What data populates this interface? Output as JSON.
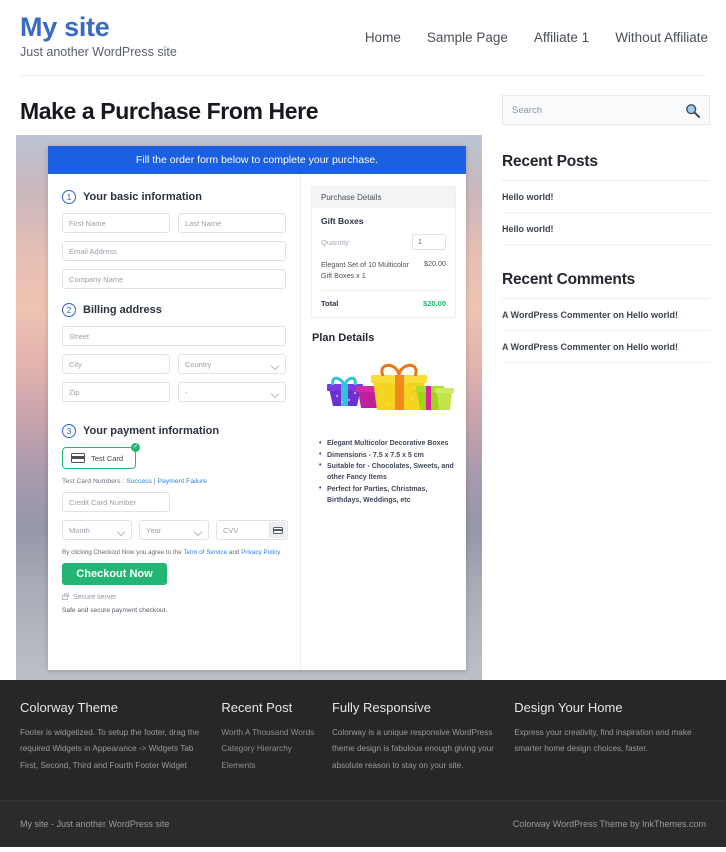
{
  "header": {
    "brand_title": "My site",
    "brand_tagline": "Just another WordPress site",
    "nav": [
      {
        "label": "Home"
      },
      {
        "label": "Sample Page"
      },
      {
        "label": "Affiliate 1"
      },
      {
        "label": "Without Affiliate"
      }
    ]
  },
  "page": {
    "title": "Make a Purchase From Here"
  },
  "order_form": {
    "banner": "Fill the order form below to complete your purchase.",
    "steps": [
      {
        "num": "1",
        "label": "Your basic information"
      },
      {
        "num": "2",
        "label": "Billing address"
      },
      {
        "num": "3",
        "label": "Your payment information"
      }
    ],
    "fields": {
      "first_name": "First Name",
      "last_name": "Last Name",
      "email": "Email Address",
      "company": "Company Name",
      "street": "Street",
      "city": "City",
      "country": "Country",
      "zip": "Zip",
      "state": "-",
      "credit_card": "Credit Card Number",
      "month": "Month",
      "year": "Year",
      "cvv": "CVV"
    },
    "payment": {
      "method_label": "Test Card",
      "check_glyph": "✓",
      "test_numbers_prefix": "Test Card Numbers : ",
      "test_success": "Success",
      "test_separator": " | ",
      "test_failure": "Payment Failure"
    },
    "terms": {
      "prefix": "By clicking Checkout Now you agree to the ",
      "tos_link": "Term of Service",
      "middle": " and ",
      "privacy_link": "Privacy Policy"
    },
    "checkout_button": "Checkout Now",
    "secure_server": "Secure server",
    "safe_note": "Safe and secure payment checkout."
  },
  "purchase_details": {
    "header": "Purchase Details",
    "product": "Gift Boxes",
    "quantity_label": "Quantity",
    "quantity_value": "1",
    "line_item_name": "Elegant Set of 10 Multicolor Gift Boxes x 1",
    "line_item_price": "$20.00",
    "total_label": "Total",
    "total_value": "$20.00"
  },
  "plan_details": {
    "title": "Plan Details",
    "features": [
      "Elegant Multicolor Decorative Boxes",
      "Dimensions - 7.5 x 7.5 x 5 cm",
      "Suitable for - Chocolates, Sweets, and other Fancy Items",
      "Perfect for Parties, Christmas, Birthdays, Weddings, etc"
    ]
  },
  "sidebar": {
    "search_placeholder": "Search",
    "search_icon": "search-icon",
    "recent_posts_title": "Recent Posts",
    "recent_posts": [
      {
        "label": "Hello world!"
      },
      {
        "label": "Hello world!"
      }
    ],
    "recent_comments_title": "Recent Comments",
    "recent_comments": [
      {
        "label": "A WordPress Commenter on Hello world!"
      },
      {
        "label": "A WordPress Commenter on Hello world!"
      }
    ]
  },
  "footer": {
    "columns": [
      {
        "title": "Colorway Theme",
        "text": "Footer is widgetized. To setup the footer, drag the required Widgets in Appearance -> Widgets Tab First, Second, Third and Fourth Footer Widget"
      },
      {
        "title": "Recent Post",
        "links": [
          {
            "label": "Worth A Thousand Words"
          },
          {
            "label": "Category Hierarchy"
          },
          {
            "label": "Elements"
          }
        ]
      },
      {
        "title": "Fully Responsive",
        "text": "Colorway is a unique responsive WordPress theme design is fabulous enough giving your absolute reason to stay on your site."
      },
      {
        "title": "Design Your Home",
        "text": "Express your creativity, find inspiration and make smarter home design choices, faster."
      }
    ],
    "bottom_left": "My site - Just another WordPress site",
    "bottom_right": "Colorway WordPress Theme by InkThemes.com"
  },
  "colors": {
    "brand_blue": "#3a69c8",
    "banner_blue": "#1b60e0",
    "accent_green": "#24b473",
    "footer_dark": "#272727"
  }
}
